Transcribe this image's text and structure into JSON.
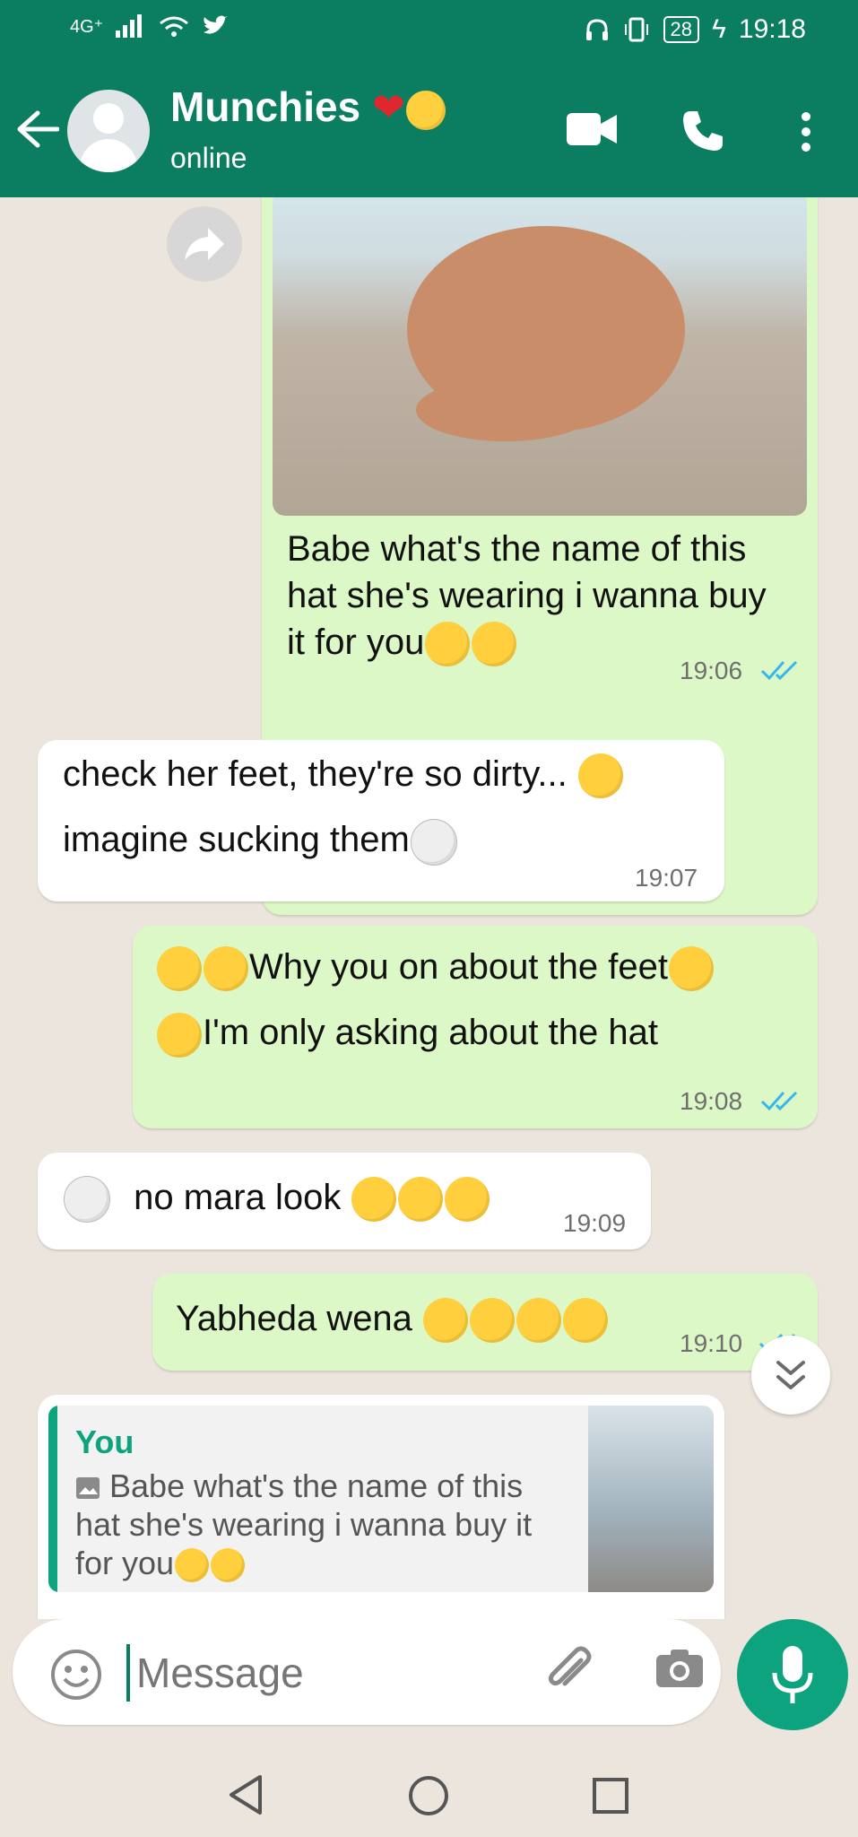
{
  "status_bar": {
    "network": "4G⁺",
    "battery": "28",
    "time": "19:18"
  },
  "header": {
    "contact_name": "Munchies",
    "contact_status": "online"
  },
  "messages": [
    {
      "direction": "out",
      "text_lines": [
        "Babe what's the name of this",
        "hat she's wearing i wanna buy",
        "it for you"
      ],
      "time": "19:06"
    },
    {
      "direction": "in",
      "text_lines": [
        "check her feet, they're so dirty...",
        "imagine sucking them"
      ],
      "time": "19:07"
    },
    {
      "direction": "out",
      "text_lines": [
        "Why you on about the feet",
        "I'm only asking about the hat"
      ],
      "time": "19:08"
    },
    {
      "direction": "in",
      "text": "no mara look",
      "time": "19:09"
    },
    {
      "direction": "out",
      "text": "Yabheda wena",
      "time": "19:10"
    }
  ],
  "reply_preview": {
    "author": "You",
    "text_lines": [
      "Babe what's the name of this",
      "hat she's wearing i wanna buy it",
      "for you"
    ]
  },
  "input": {
    "placeholder": "Message"
  },
  "colors": {
    "header": "#0b7d61",
    "accent": "#0ea37f",
    "outgoing": "#dcf8c6",
    "incoming": "#ffffff",
    "chat_bg": "#ece5dd",
    "read_ticks": "#34b7f1"
  },
  "icons": [
    "arrow-left-icon",
    "video-call-icon",
    "phone-icon",
    "more-vert-icon",
    "forward-icon",
    "double-check-icon",
    "emoji-icon",
    "attach-icon",
    "camera-icon",
    "mic-icon",
    "chevron-double-down-icon",
    "nav-back-icon",
    "nav-home-icon",
    "nav-recents-icon"
  ]
}
